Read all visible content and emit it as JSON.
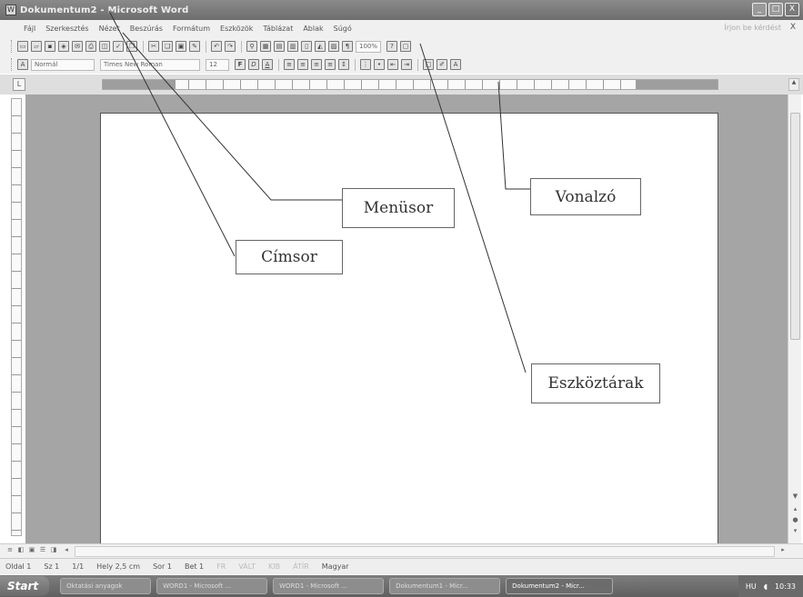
{
  "window": {
    "title": "Dokumentum2 - Microsoft Word",
    "buttons": [
      "_",
      "□",
      "X"
    ]
  },
  "menubar": {
    "items": [
      "Fájl",
      "Szerkesztés",
      "Nézet",
      "Beszúrás",
      "Formátum",
      "Eszközök",
      "Táblázat",
      "Ablak",
      "Súgó"
    ],
    "help_placeholder": "Írjon be kérdést",
    "close": "X"
  },
  "toolbar1": {
    "zoom": "100%"
  },
  "toolbar2": {
    "style": "Normál",
    "font": "Times New Roman",
    "size": "12"
  },
  "statusbar": {
    "page": "Oldal 1",
    "section": "Sz 1",
    "pages": "1/1",
    "position": "Hely 2,5 cm",
    "line": "Sor 1",
    "column": "Bet 1",
    "flags": [
      "FR",
      "VÁLT",
      "KIB",
      "ÁTÍR"
    ],
    "language": "Magyar"
  },
  "taskbar": {
    "start": "Start",
    "tasks": [
      "Oktatási anyagok",
      "WORD1 - Microsoft ...",
      "WORD1 - Microsoft ...",
      "Dokumentum1 - Micr...",
      "Dokumentum2 - Micr..."
    ],
    "tray_lang": "HU",
    "clock": "10:33"
  },
  "annotations": {
    "menusor": "Menüsor",
    "cimsor": "Címsor",
    "vonalzo": "Vonalzó",
    "eszkoztarak": "Eszköztárak"
  }
}
